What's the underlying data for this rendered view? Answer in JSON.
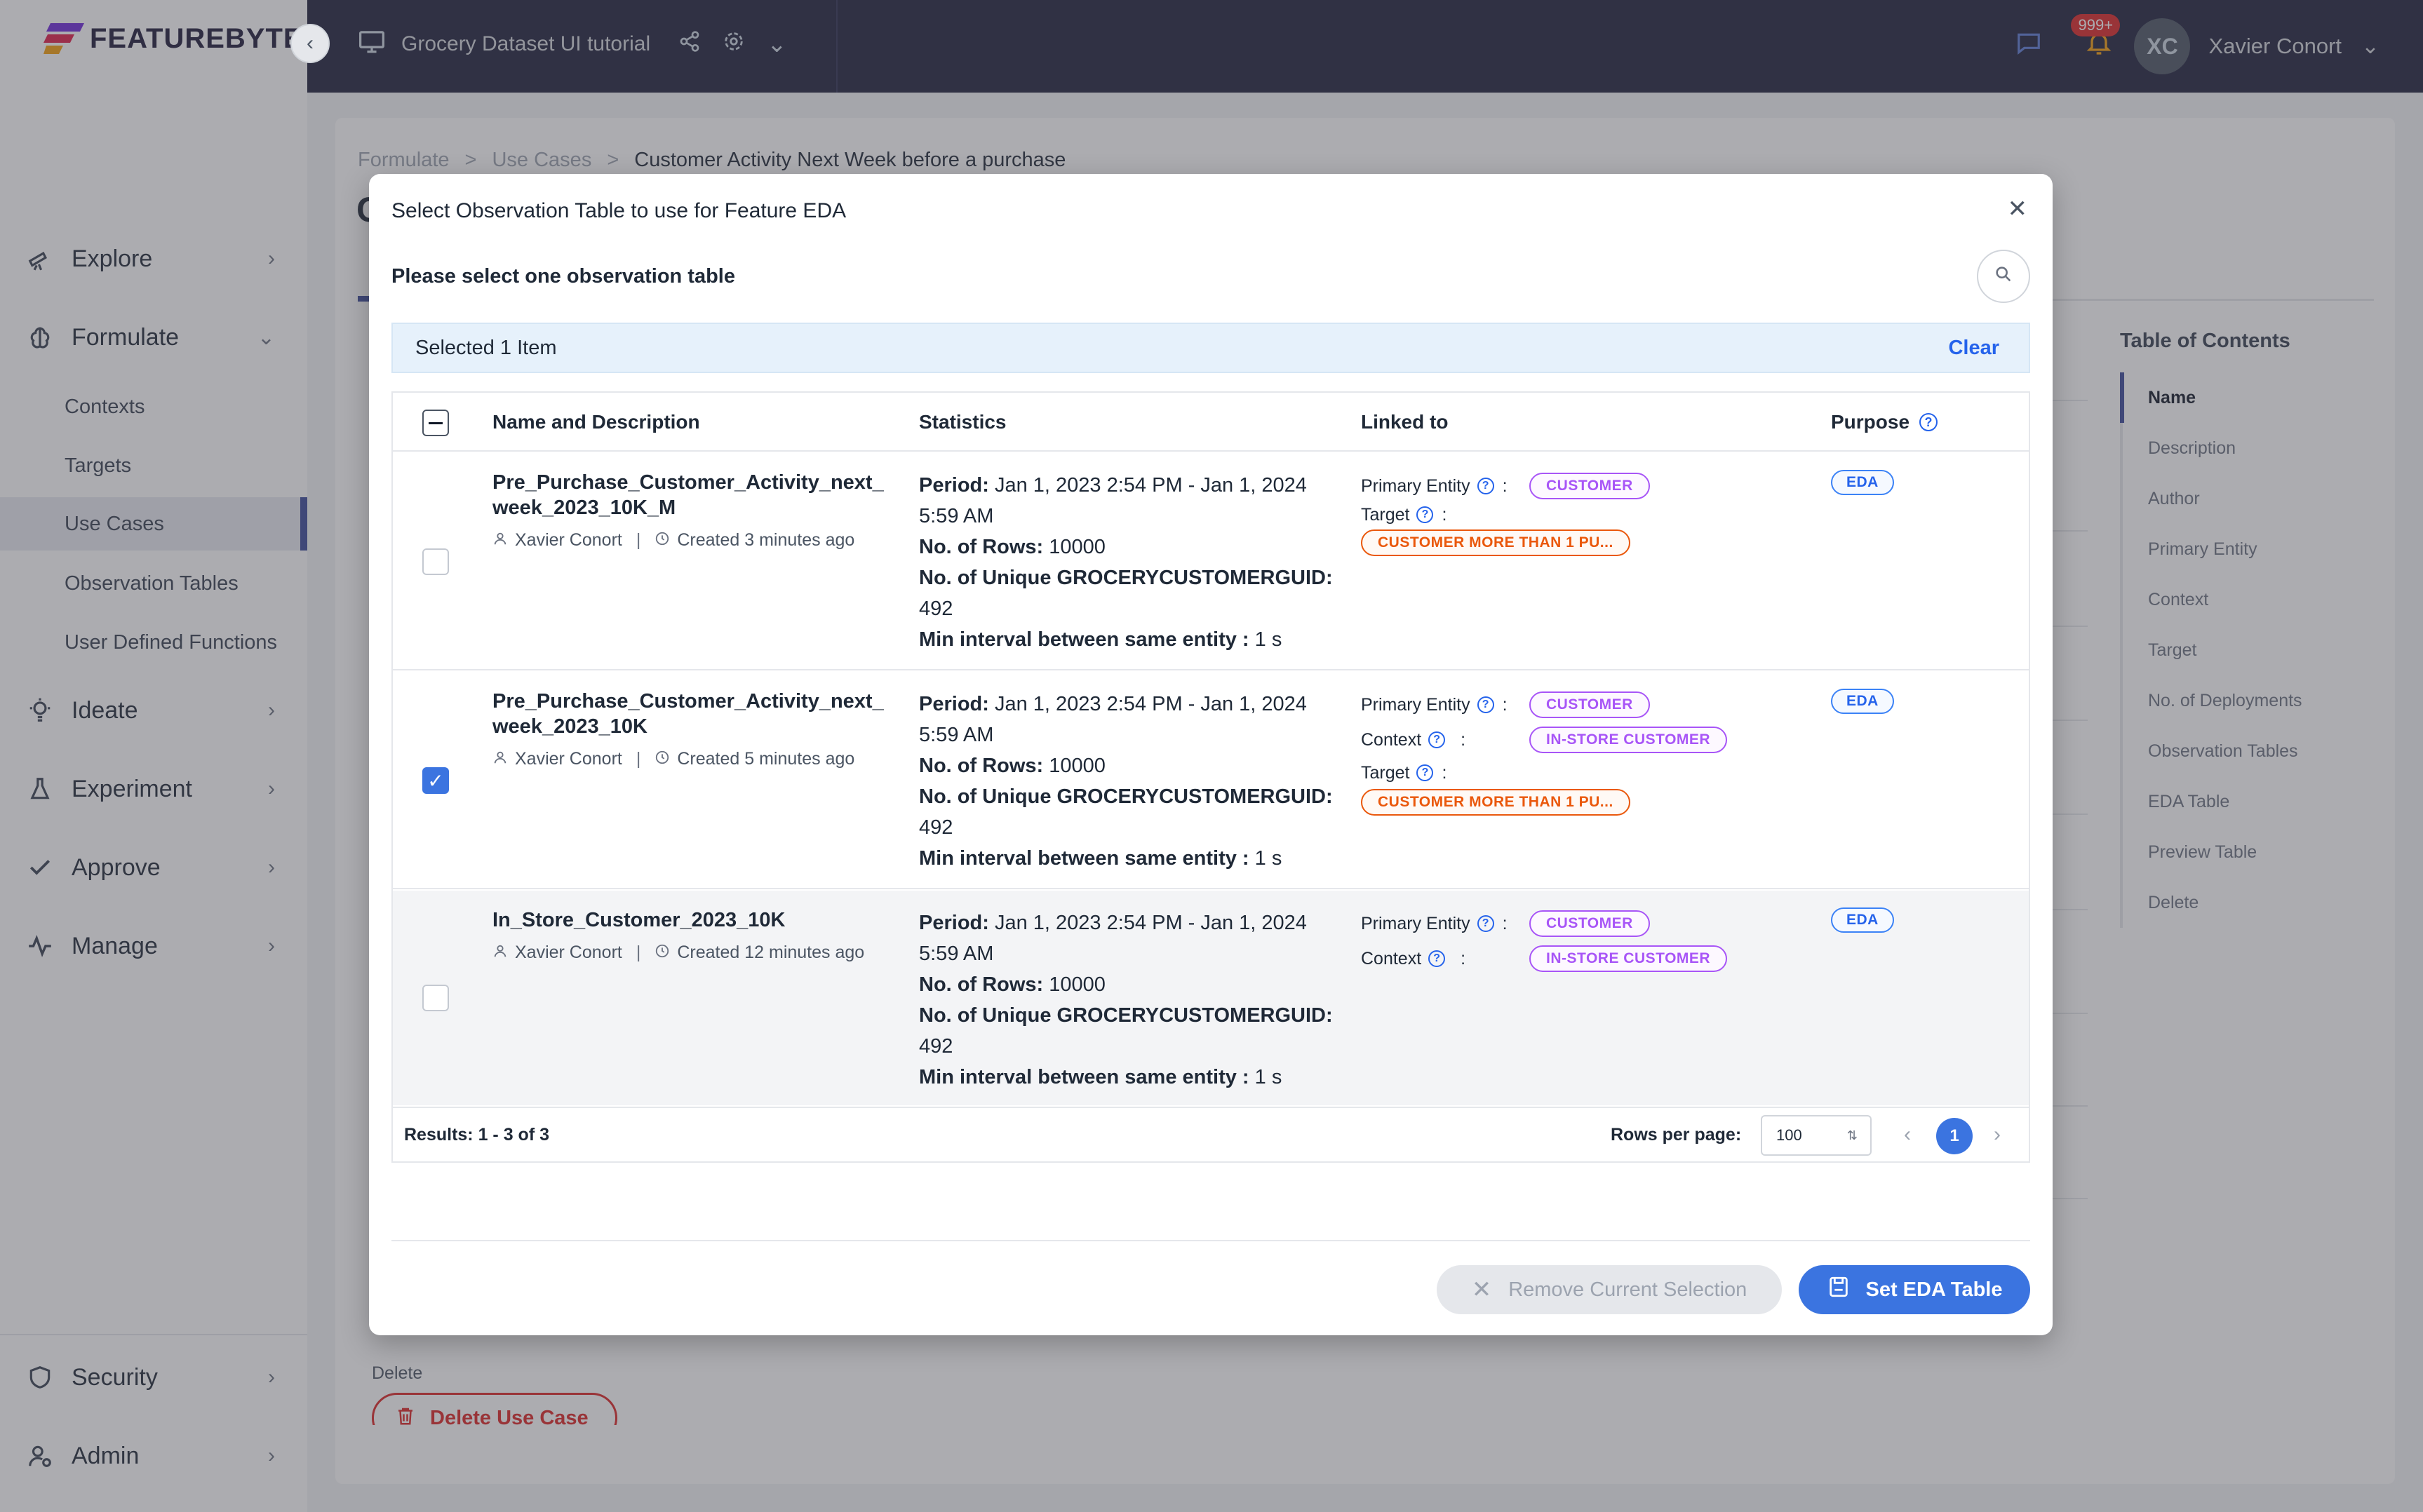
{
  "app": {
    "logo_text": "FEATUREBYTE",
    "project_name": "Grocery Dataset UI tutorial",
    "user_initials": "XC",
    "user_name": "Xavier Conort",
    "notification_badge": "999+"
  },
  "sidebar": {
    "explore": "Explore",
    "formulate": "Formulate",
    "formulate_sub": [
      "Contexts",
      "Targets",
      "Use Cases",
      "Observation Tables",
      "User Defined Functions"
    ],
    "ideate": "Ideate",
    "experiment": "Experiment",
    "approve": "Approve",
    "manage": "Manage",
    "security": "Security",
    "admin": "Admin"
  },
  "main": {
    "breadcrumb": [
      "Formulate",
      ">",
      "Use Cases",
      ">",
      "Customer Activity Next Week before a purchase"
    ],
    "title_fragment": "C",
    "toc_title": "Table of Contents",
    "toc": [
      "Name",
      "Description",
      "Author",
      "Primary Entity",
      "Context",
      "Target",
      "No. of Deployments",
      "Observation Tables",
      "EDA Table",
      "Preview Table",
      "Delete"
    ],
    "delete_label": "Delete",
    "delete_button": "Delete Use Case"
  },
  "modal": {
    "title": "Select Observation Table to use for Feature EDA",
    "subtitle": "Please select one observation table",
    "selected_text": "Selected 1 Item",
    "clear": "Clear",
    "columns": {
      "name": "Name and Description",
      "statistics": "Statistics",
      "linked": "Linked to",
      "purpose": "Purpose"
    },
    "labels": {
      "period": "Period:",
      "rows": "No. of Rows:",
      "unique": "No. of Unique GROCERYCUSTOMERGUID:",
      "interval": "Min interval between same entity :",
      "primary_entity": "Primary Entity",
      "context": "Context",
      "target": "Target",
      "colon": ":",
      "sep": "|"
    },
    "rows": [
      {
        "name": "Pre_Purchase_Customer_Activity_next_week_2023_10K_M",
        "author": "Xavier Conort",
        "created": "Created 3 minutes ago",
        "period": "Jan 1, 2023 2:54 PM - Jan 1, 2024 5:59 AM",
        "rows": "10000",
        "unique": "492",
        "interval": "1 s",
        "primary_entity": "CUSTOMER",
        "target": "CUSTOMER MORE THAN 1 PU...",
        "purpose": "EDA",
        "checked": false
      },
      {
        "name": "Pre_Purchase_Customer_Activity_next_week_2023_10K",
        "author": "Xavier Conort",
        "created": "Created 5 minutes ago",
        "period": "Jan 1, 2023 2:54 PM - Jan 1, 2024 5:59 AM",
        "rows": "10000",
        "unique": "492",
        "interval": "1 s",
        "primary_entity": "CUSTOMER",
        "context": "IN-STORE CUSTOMER",
        "target": "CUSTOMER MORE THAN 1 PU...",
        "purpose": "EDA",
        "checked": true
      },
      {
        "name": "In_Store_Customer_2023_10K",
        "author": "Xavier Conort",
        "created": "Created 12 minutes ago",
        "period": "Jan 1, 2023 2:54 PM - Jan 1, 2024 5:59 AM",
        "rows": "10000",
        "unique": "492",
        "interval": "1 s",
        "primary_entity": "CUSTOMER",
        "context": "IN-STORE CUSTOMER",
        "purpose": "EDA",
        "checked": false
      }
    ],
    "results": "Results: 1 - 3 of 3",
    "rows_per_page_label": "Rows per page:",
    "rows_per_page_value": "100",
    "current_page": "1",
    "remove_button": "Remove Current Selection",
    "set_button": "Set EDA Table"
  },
  "colors": {
    "topbar": "#1e1f3b",
    "accent_blue": "#3b74e0",
    "entity_purple": "#a855f7",
    "target_orange": "#ea580c",
    "danger": "#dc2626"
  }
}
